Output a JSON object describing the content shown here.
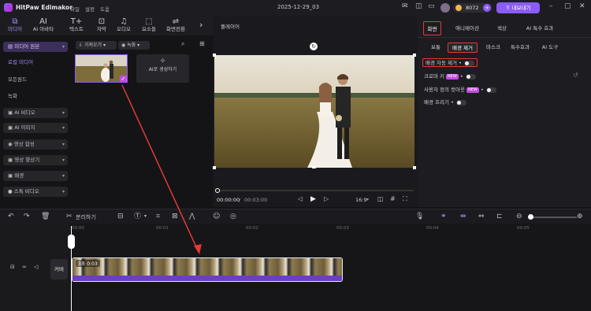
{
  "app": {
    "name": "HitPaw Edimakor",
    "menus": [
      "파일",
      "설정",
      "도움"
    ],
    "project_title": "2025-12-29_03",
    "coins": "8072",
    "export_label": "내보내기"
  },
  "colors": {
    "accent": "#8b5cf6",
    "highlight": "#e53935",
    "clip": "#6a3fc5"
  },
  "nav_tabs": [
    {
      "icon": "media-icon",
      "label": "미디어"
    },
    {
      "icon": "ai-icon",
      "label": "AI 아바타"
    },
    {
      "icon": "text-icon",
      "label": "텍스트"
    },
    {
      "icon": "subtitle-icon",
      "label": "자막"
    },
    {
      "icon": "audio-icon",
      "label": "오디오"
    },
    {
      "icon": "elements-icon",
      "label": "요소들"
    },
    {
      "icon": "transition-icon",
      "label": "화면전환"
    }
  ],
  "sidebar": {
    "items": [
      {
        "label": "미디어 원본",
        "group": true
      },
      {
        "label": "로컬 미디어",
        "group": false
      },
      {
        "label": "모든원드",
        "group": false
      },
      {
        "label": "녹화",
        "group": false
      },
      {
        "label": "AI 비디오",
        "group": true
      },
      {
        "label": "AI 이미지",
        "group": true
      },
      {
        "label": "영상 합성",
        "group": true
      },
      {
        "label": "영상 향상기",
        "group": true
      },
      {
        "label": "배경",
        "group": true
      },
      {
        "label": "스톡 비디오",
        "group": true
      }
    ]
  },
  "media": {
    "sort_label": "가져오기",
    "filter_label": "녹화",
    "ai_generate_label": "AI로 생성하기"
  },
  "player": {
    "title": "플레이어",
    "time_current": "00:00:00",
    "time_total": "00:03:00",
    "ratio": "16:9"
  },
  "right_panel": {
    "tabs": [
      "화면",
      "애니메이션",
      "색상",
      "AI 특수 효과"
    ],
    "subtabs": [
      "보통",
      "배경 제거",
      "마스크",
      "특수효과",
      "AI 도구"
    ],
    "options": [
      {
        "label": "배경 자동 제거",
        "new": false
      },
      {
        "label": "크로마 키",
        "new": true
      },
      {
        "label": "사용자 정의 컷아웃",
        "new": true
      },
      {
        "label": "배경 흐리기",
        "new": false
      }
    ],
    "new_badge": "NEW"
  },
  "toolbar": {
    "split_label": "분리하기"
  },
  "timeline": {
    "ticks": [
      "00:00",
      "00:01",
      "00:02",
      "00:03",
      "00:04",
      "00:05"
    ],
    "track_label": "커버",
    "clip_label": "3초 0:03"
  }
}
